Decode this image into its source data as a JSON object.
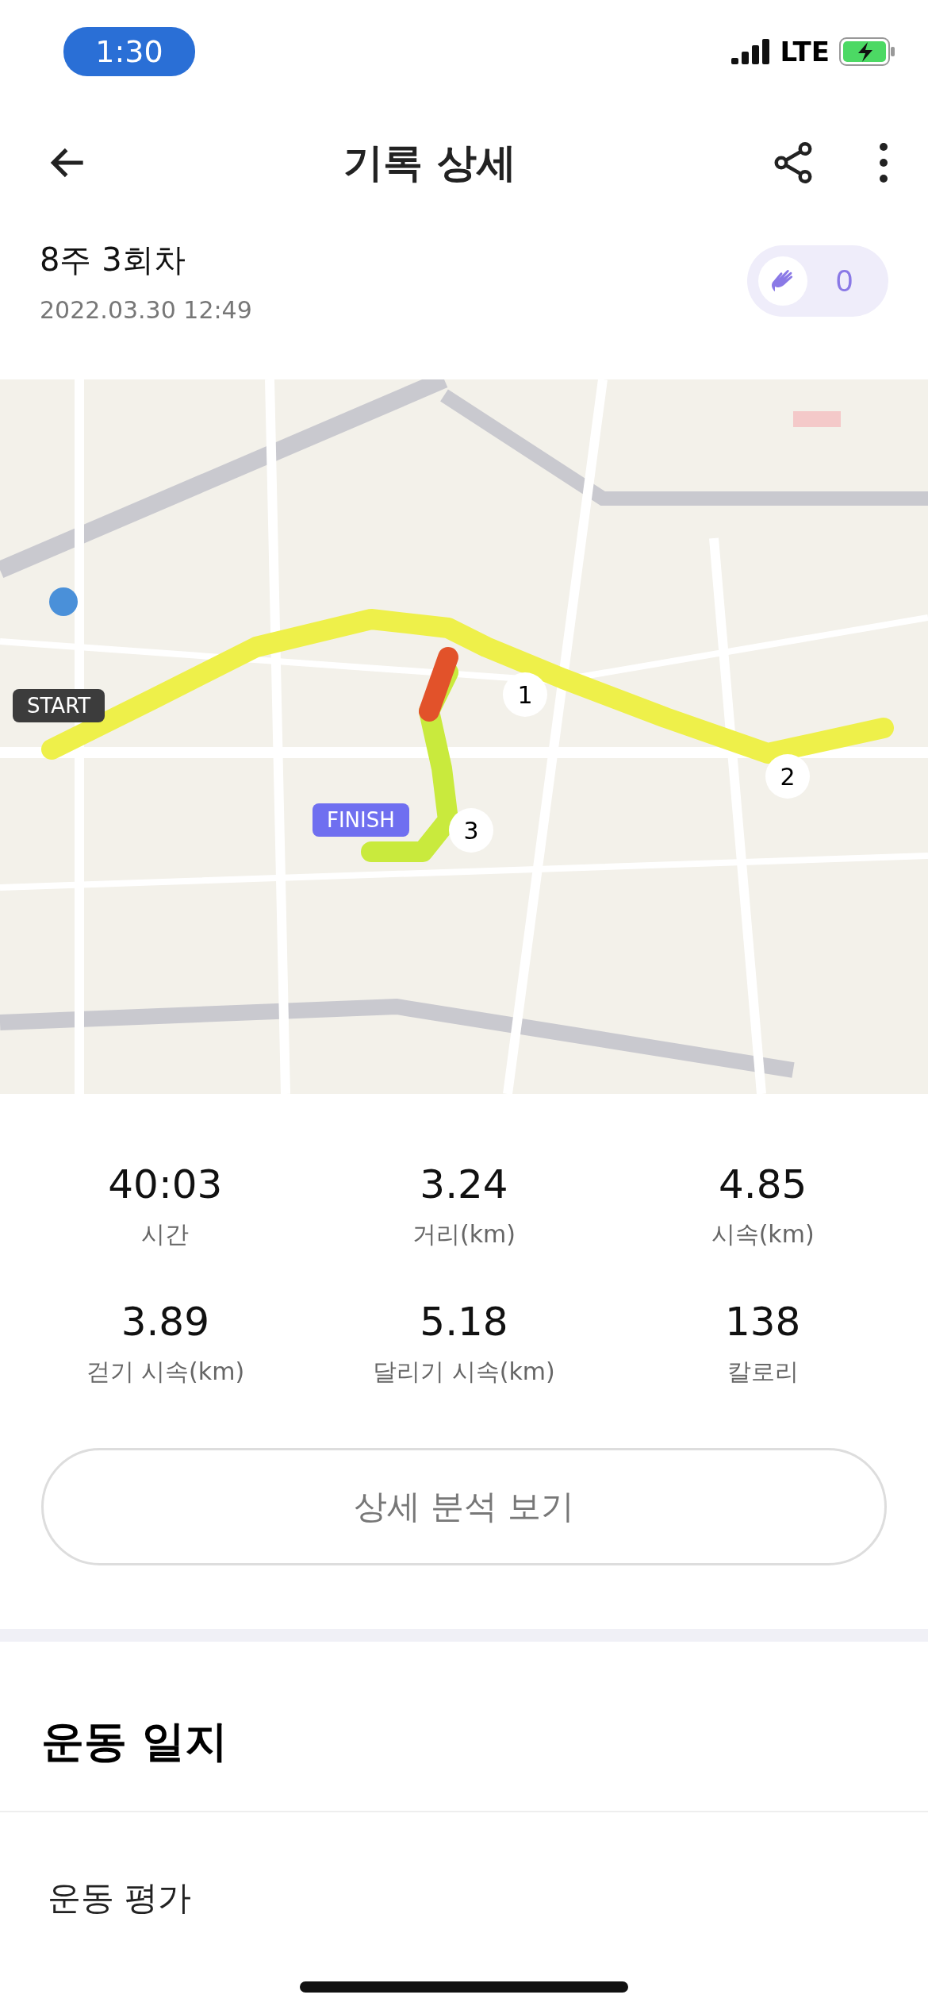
{
  "status_bar": {
    "time": "1:30",
    "network": "LTE"
  },
  "header": {
    "title": "기록 상세"
  },
  "record": {
    "title": "8주 3회차",
    "date": "2022.03.30 12:49",
    "claps": "0"
  },
  "map": {
    "start_label": "START",
    "finish_label": "FINISH",
    "markers": [
      "1",
      "2",
      "3"
    ]
  },
  "stats": [
    {
      "value": "40:03",
      "label": "시간"
    },
    {
      "value": "3.24",
      "label": "거리(km)"
    },
    {
      "value": "4.85",
      "label": "시속(km)"
    },
    {
      "value": "3.89",
      "label": "걷기 시속(km)"
    },
    {
      "value": "5.18",
      "label": "달리기 시속(km)"
    },
    {
      "value": "138",
      "label": "칼로리"
    }
  ],
  "detail_button": "상세 분석 보기",
  "journal": {
    "title": "운동 일지",
    "items": [
      "운동 평가"
    ]
  }
}
